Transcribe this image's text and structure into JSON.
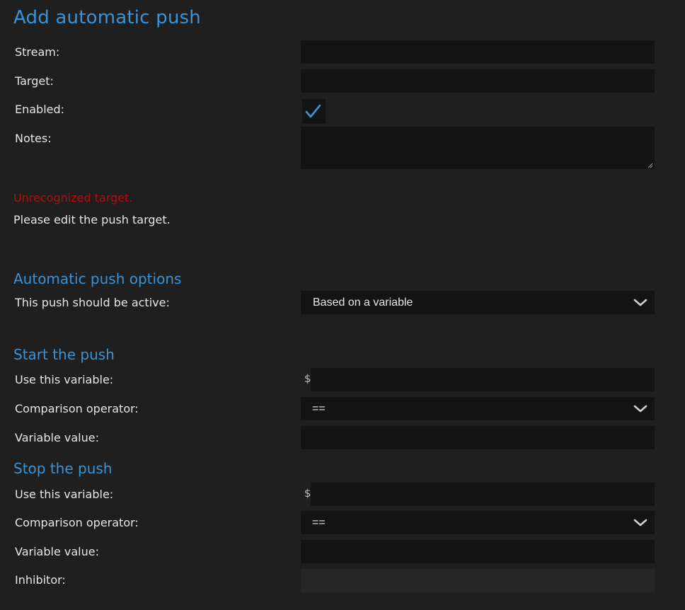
{
  "page": {
    "title": "Add automatic push"
  },
  "form": {
    "stream_label": "Stream:",
    "stream_value": "",
    "target_label": "Target:",
    "target_value": "",
    "enabled_label": "Enabled:",
    "enabled_checked": true,
    "notes_label": "Notes:",
    "notes_value": ""
  },
  "messages": {
    "error": "Unrecognized target.",
    "info": "Please edit the push target."
  },
  "options": {
    "heading": "Automatic push options",
    "active_label": "This push should be active:",
    "active_value": "Based on a variable"
  },
  "start": {
    "heading": "Start the push",
    "variable_label": "Use this variable:",
    "variable_prefix": "$",
    "variable_value": "",
    "operator_label": "Comparison operator:",
    "operator_value": "==",
    "value_label": "Variable value:",
    "value_value": ""
  },
  "stop": {
    "heading": "Stop the push",
    "variable_label": "Use this variable:",
    "variable_prefix": "$",
    "variable_value": "",
    "operator_label": "Comparison operator:",
    "operator_value": "==",
    "value_label": "Variable value:",
    "value_value": "",
    "inhibitor_label": "Inhibitor:",
    "inhibitor_value": ""
  },
  "colors": {
    "accent": "#3a93d6",
    "error": "#b10e0e",
    "background": "#1f1f1f",
    "field": "#141414"
  },
  "icons": {
    "checkbox": "checkmark-icon",
    "select": "chevron-down-icon",
    "textarea": "resize-grip-icon"
  }
}
